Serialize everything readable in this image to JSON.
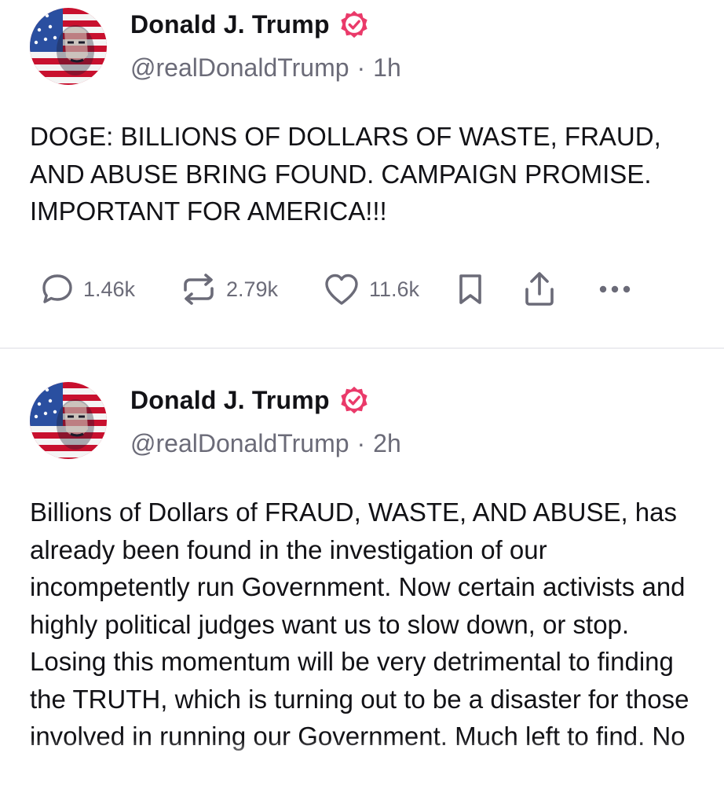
{
  "posts": [
    {
      "author": {
        "display_name": "Donald J. Trump",
        "handle": "@realDonaldTrump",
        "verified": true
      },
      "time": "1h",
      "separator": "·",
      "text": "DOGE: BILLIONS OF DOLLARS OF WASTE, FRAUD, AND ABUSE BRING FOUND. CAMPAIGN PROMISE. IMPORTANT FOR AMERICA!!!",
      "actions": {
        "replies": "1.46k",
        "retruths": "2.79k",
        "likes": "11.6k"
      }
    },
    {
      "author": {
        "display_name": "Donald J. Trump",
        "handle": "@realDonaldTrump",
        "verified": true
      },
      "time": "2h",
      "separator": "·",
      "text": "Billions of Dollars of FRAUD, WASTE, AND ABUSE, has already been found in the investigation of our incompetently run Government. Now certain activists and highly political judges want us to slow down, or stop. Losing this momentum will be very detrimental to finding the TRUTH, which is turning out to be a disaster for those involved in running our Government. Much left to find. No"
    }
  ],
  "icons": {
    "verified": "verified-badge-icon",
    "reply": "reply-bubble-icon",
    "retruth": "retruth-arrows-icon",
    "like": "heart-icon",
    "bookmark": "bookmark-icon",
    "share": "share-icon",
    "more": "more-dots-icon"
  },
  "colors": {
    "accent": "#ea3a6a",
    "text": "#121216",
    "secondary": "#6b6b78",
    "divider": "#ececf0"
  }
}
